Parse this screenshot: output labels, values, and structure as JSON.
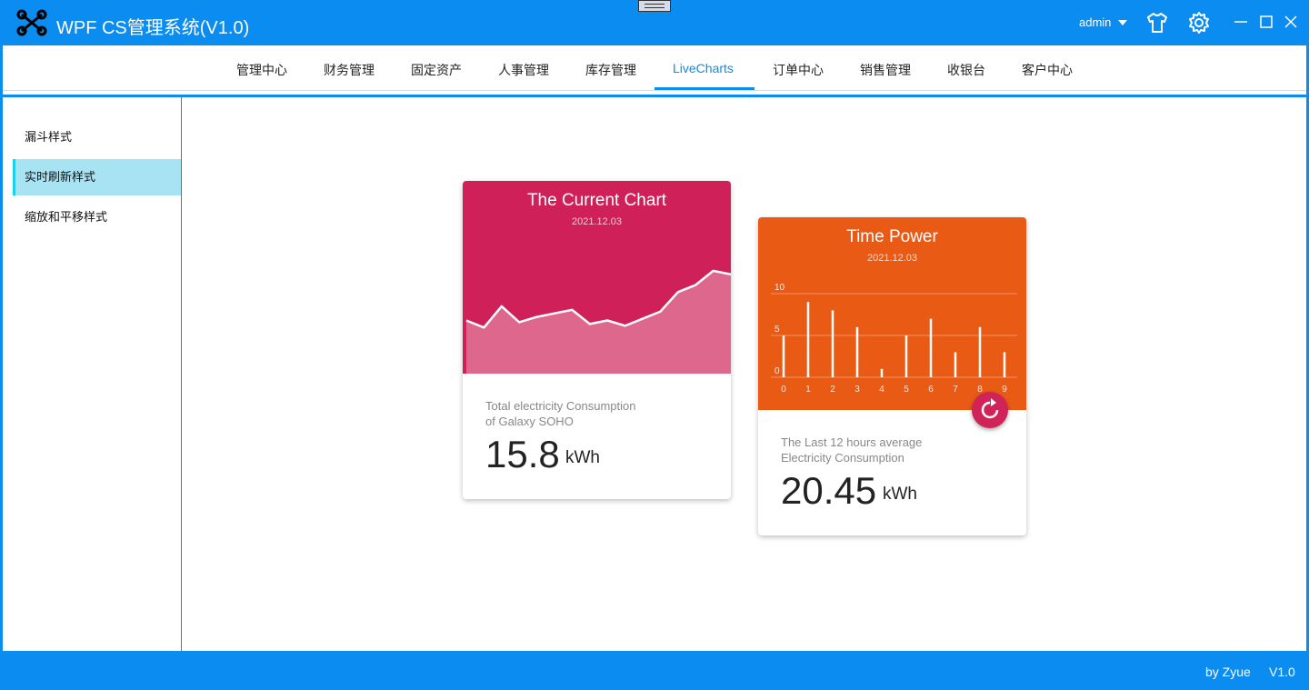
{
  "window": {
    "title": "WPF CS管理系统(V1.0)",
    "user": "admin",
    "icons": [
      "app-logo-icon",
      "skin-shirt-icon",
      "settings-gear-icon",
      "minimize-icon",
      "maximize-icon",
      "close-icon"
    ]
  },
  "nav": {
    "items": [
      "管理中心",
      "财务管理",
      "固定资产",
      "人事管理",
      "库存管理",
      "LiveCharts",
      "订单中心",
      "销售管理",
      "收银台",
      "客户中心"
    ],
    "active": "LiveCharts"
  },
  "sidebar": {
    "items": [
      "漏斗样式",
      "实时刷新样式",
      "缩放和平移样式"
    ],
    "active": "实时刷新样式"
  },
  "card1": {
    "title": "The Current Chart",
    "date": "2021.12.03",
    "desc_line1": "Total electricity Consumption",
    "desc_line2": "of Galaxy SOHO",
    "value": "15.8",
    "unit": "kWh",
    "color": "#cf2059"
  },
  "card2": {
    "title": "Time Power",
    "date": "2021.12.03",
    "desc_line1": "The Last 12 hours average",
    "desc_line2": "Electricity Consumption",
    "value": "20.45",
    "unit": "kWh",
    "color": "#e95a14",
    "fab_icon": "refresh-icon"
  },
  "chart_data": [
    {
      "type": "area",
      "series": [
        {
          "values": [
            3.0,
            2.6,
            3.8,
            2.9,
            3.2,
            3.4,
            3.6,
            2.8,
            3.0,
            2.7,
            3.1,
            3.5,
            4.6,
            5.0,
            5.8,
            5.6
          ]
        }
      ],
      "xlabel": "",
      "ylabel": "",
      "grid": false,
      "color": "#cf2059"
    },
    {
      "type": "bar",
      "categories": [
        "0",
        "1",
        "2",
        "3",
        "4",
        "5",
        "6",
        "7",
        "8",
        "9"
      ],
      "y_ticks": [
        "10",
        "5",
        "0"
      ],
      "series": [
        {
          "values": [
            5,
            9,
            8,
            6,
            1,
            5,
            7,
            3,
            6,
            3
          ]
        }
      ],
      "ylim": [
        0,
        10
      ],
      "grid": true,
      "color": "#e95a14"
    }
  ],
  "status": {
    "credit": "by Zyue",
    "version": "V1.0"
  }
}
